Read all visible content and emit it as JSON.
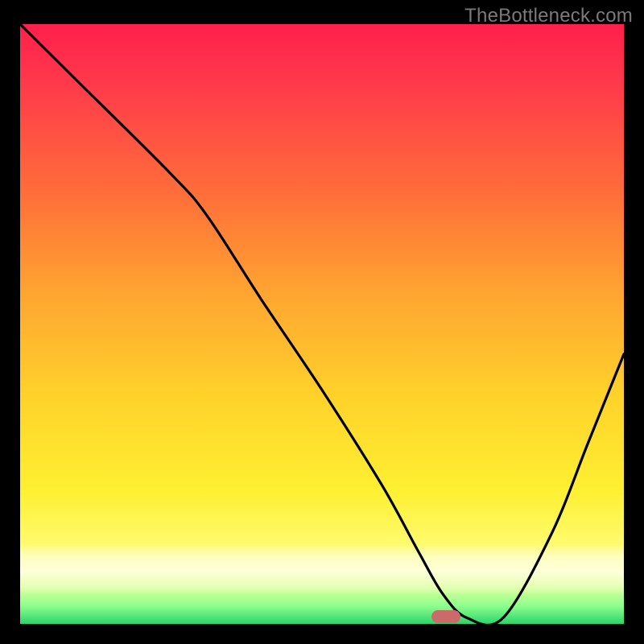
{
  "watermark": "TheBottleneck.com",
  "colors": {
    "background": "#000000",
    "curve": "#000000",
    "marker": "#cc6a6a",
    "watermark_text": "#7a7a7a"
  },
  "chart_data": {
    "type": "line",
    "title": "",
    "xlabel": "",
    "ylabel": "",
    "xlim": [
      0,
      100
    ],
    "ylim": [
      0,
      100
    ],
    "curve": {
      "x": [
        0,
        10,
        25,
        31,
        40,
        50,
        60,
        66,
        70,
        74,
        80,
        88,
        94,
        100
      ],
      "y": [
        100,
        90,
        75,
        68,
        54,
        39,
        23,
        12,
        5,
        1,
        1,
        15,
        30,
        45
      ]
    },
    "marker": {
      "x": 70.5,
      "y": 1.2
    },
    "gradient_stops": [
      {
        "pos": 0.0,
        "color": "#ff1f4b"
      },
      {
        "pos": 0.1,
        "color": "#ff3a4b"
      },
      {
        "pos": 0.28,
        "color": "#ff6d3a"
      },
      {
        "pos": 0.45,
        "color": "#ffa531"
      },
      {
        "pos": 0.62,
        "color": "#ffd22a"
      },
      {
        "pos": 0.78,
        "color": "#fef032"
      },
      {
        "pos": 0.87,
        "color": "#fffb70"
      },
      {
        "pos": 0.91,
        "color": "#fcffa8"
      },
      {
        "pos": 0.94,
        "color": "#d8ff9a"
      },
      {
        "pos": 0.97,
        "color": "#8dff8d"
      },
      {
        "pos": 1.0,
        "color": "#2bd46b"
      }
    ]
  }
}
